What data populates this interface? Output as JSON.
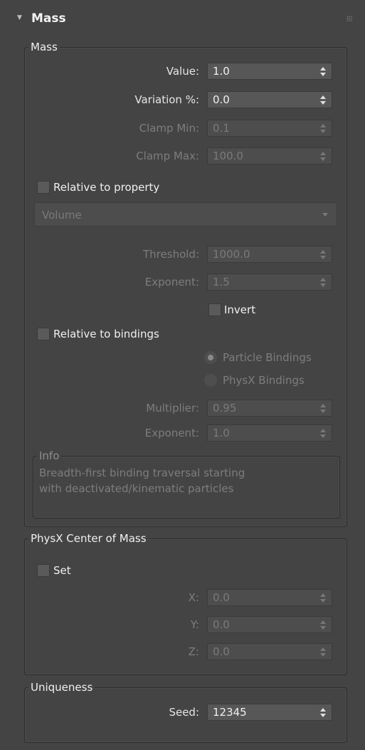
{
  "rollout": {
    "title": "Mass"
  },
  "mass_group": {
    "label": "Mass",
    "value": {
      "label": "Value:",
      "value": "1.0"
    },
    "variation": {
      "label": "Variation %:",
      "value": "0.0"
    },
    "clamp_min": {
      "label": "Clamp Min:",
      "value": "0.1"
    },
    "clamp_max": {
      "label": "Clamp Max:",
      "value": "100.0"
    },
    "relative_to_property": {
      "label": "Relative to property",
      "checked": false
    },
    "property_dropdown": {
      "value": "Volume"
    },
    "threshold": {
      "label": "Threshold:",
      "value": "1000.0"
    },
    "exponent1": {
      "label": "Exponent:",
      "value": "1.5"
    },
    "invert": {
      "label": "Invert",
      "checked": false
    },
    "relative_to_bindings": {
      "label": "Relative to bindings",
      "checked": false
    },
    "radio_particle": {
      "label": "Particle Bindings",
      "selected": true
    },
    "radio_physx": {
      "label": "PhysX Bindings",
      "selected": false
    },
    "multiplier": {
      "label": "Multiplier:",
      "value": "0.95"
    },
    "exponent2": {
      "label": "Exponent:",
      "value": "1.0"
    },
    "info": {
      "label": "Info",
      "line1": "Breadth-first binding traversal starting",
      "line2": "with deactivated/kinematic particles"
    }
  },
  "physx_group": {
    "label": "PhysX Center of Mass",
    "set": {
      "label": "Set",
      "checked": false
    },
    "x": {
      "label": "X:",
      "value": "0.0"
    },
    "y": {
      "label": "Y:",
      "value": "0.0"
    },
    "z": {
      "label": "Z:",
      "value": "0.0"
    }
  },
  "uniqueness_group": {
    "label": "Uniqueness",
    "seed": {
      "label": "Seed:",
      "value": "12345"
    }
  }
}
